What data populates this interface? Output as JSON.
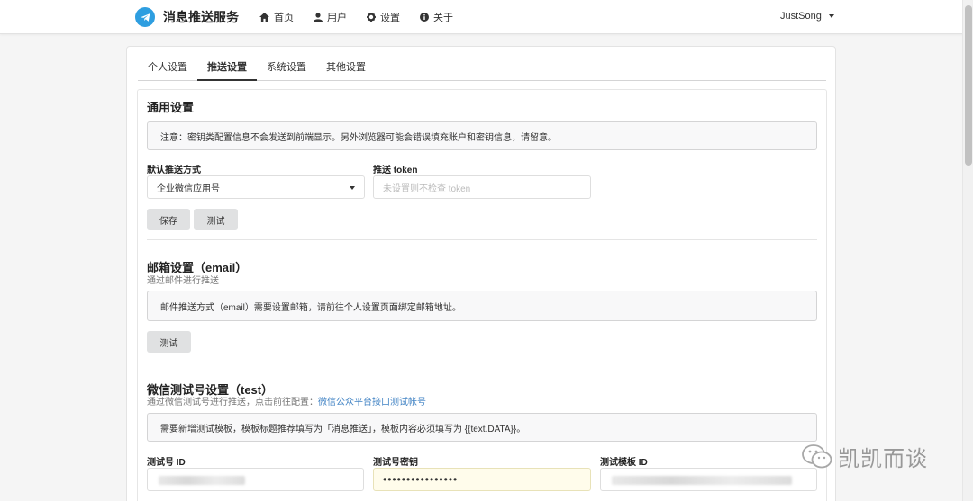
{
  "nav": {
    "brand": "消息推送服务",
    "items": [
      "首页",
      "用户",
      "设置",
      "关于"
    ],
    "user": "JustSong"
  },
  "tabs": [
    "个人设置",
    "推送设置",
    "系统设置",
    "其他设置"
  ],
  "general": {
    "title": "通用设置",
    "notice": "注意：密钥类配置信息不会发送到前端显示。另外浏览器可能会错误填充账户和密钥信息，请留意。",
    "method_label": "默认推送方式",
    "method_value": "企业微信应用号",
    "token_label": "推送 token",
    "token_placeholder": "未设置则不检查 token",
    "save_button": "保存",
    "test_button": "测试"
  },
  "email": {
    "title": "邮箱设置（email）",
    "subtitle": "通过邮件进行推送",
    "notice": "邮件推送方式（email）需要设置邮箱，请前往个人设置页面绑定邮箱地址。",
    "test_button": "测试"
  },
  "wechat_test": {
    "title": "微信测试号设置（test）",
    "subtitle": "通过微信测试号进行推送，点击前往配置：",
    "link": "微信公众平台接口测试帐号",
    "notice": "需要新增测试模板，模板标题推荐填写为「消息推送」，模板内容必须填写为 {{text.DATA}}。",
    "id_label": "测试号 ID",
    "secret_label": "测试号密钥",
    "secret_value": "••••••••••••••••",
    "template_label": "测试模板 ID"
  },
  "watermark": "凯凯而谈",
  "colors": {
    "brand_blue": "#2e9ee0",
    "link": "#4183c4",
    "button_gray": "#e0e1e2"
  }
}
